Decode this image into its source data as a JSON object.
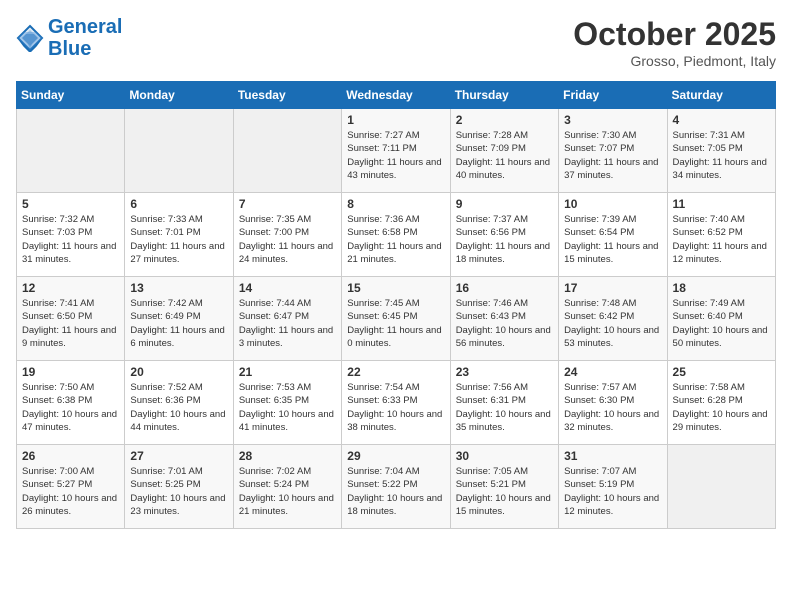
{
  "header": {
    "logo_line1": "General",
    "logo_line2": "Blue",
    "month": "October 2025",
    "location": "Grosso, Piedmont, Italy"
  },
  "days_of_week": [
    "Sunday",
    "Monday",
    "Tuesday",
    "Wednesday",
    "Thursday",
    "Friday",
    "Saturday"
  ],
  "weeks": [
    [
      {
        "day": "",
        "sunrise": "",
        "sunset": "",
        "daylight": ""
      },
      {
        "day": "",
        "sunrise": "",
        "sunset": "",
        "daylight": ""
      },
      {
        "day": "",
        "sunrise": "",
        "sunset": "",
        "daylight": ""
      },
      {
        "day": "1",
        "sunrise": "Sunrise: 7:27 AM",
        "sunset": "Sunset: 7:11 PM",
        "daylight": "Daylight: 11 hours and 43 minutes."
      },
      {
        "day": "2",
        "sunrise": "Sunrise: 7:28 AM",
        "sunset": "Sunset: 7:09 PM",
        "daylight": "Daylight: 11 hours and 40 minutes."
      },
      {
        "day": "3",
        "sunrise": "Sunrise: 7:30 AM",
        "sunset": "Sunset: 7:07 PM",
        "daylight": "Daylight: 11 hours and 37 minutes."
      },
      {
        "day": "4",
        "sunrise": "Sunrise: 7:31 AM",
        "sunset": "Sunset: 7:05 PM",
        "daylight": "Daylight: 11 hours and 34 minutes."
      }
    ],
    [
      {
        "day": "5",
        "sunrise": "Sunrise: 7:32 AM",
        "sunset": "Sunset: 7:03 PM",
        "daylight": "Daylight: 11 hours and 31 minutes."
      },
      {
        "day": "6",
        "sunrise": "Sunrise: 7:33 AM",
        "sunset": "Sunset: 7:01 PM",
        "daylight": "Daylight: 11 hours and 27 minutes."
      },
      {
        "day": "7",
        "sunrise": "Sunrise: 7:35 AM",
        "sunset": "Sunset: 7:00 PM",
        "daylight": "Daylight: 11 hours and 24 minutes."
      },
      {
        "day": "8",
        "sunrise": "Sunrise: 7:36 AM",
        "sunset": "Sunset: 6:58 PM",
        "daylight": "Daylight: 11 hours and 21 minutes."
      },
      {
        "day": "9",
        "sunrise": "Sunrise: 7:37 AM",
        "sunset": "Sunset: 6:56 PM",
        "daylight": "Daylight: 11 hours and 18 minutes."
      },
      {
        "day": "10",
        "sunrise": "Sunrise: 7:39 AM",
        "sunset": "Sunset: 6:54 PM",
        "daylight": "Daylight: 11 hours and 15 minutes."
      },
      {
        "day": "11",
        "sunrise": "Sunrise: 7:40 AM",
        "sunset": "Sunset: 6:52 PM",
        "daylight": "Daylight: 11 hours and 12 minutes."
      }
    ],
    [
      {
        "day": "12",
        "sunrise": "Sunrise: 7:41 AM",
        "sunset": "Sunset: 6:50 PM",
        "daylight": "Daylight: 11 hours and 9 minutes."
      },
      {
        "day": "13",
        "sunrise": "Sunrise: 7:42 AM",
        "sunset": "Sunset: 6:49 PM",
        "daylight": "Daylight: 11 hours and 6 minutes."
      },
      {
        "day": "14",
        "sunrise": "Sunrise: 7:44 AM",
        "sunset": "Sunset: 6:47 PM",
        "daylight": "Daylight: 11 hours and 3 minutes."
      },
      {
        "day": "15",
        "sunrise": "Sunrise: 7:45 AM",
        "sunset": "Sunset: 6:45 PM",
        "daylight": "Daylight: 11 hours and 0 minutes."
      },
      {
        "day": "16",
        "sunrise": "Sunrise: 7:46 AM",
        "sunset": "Sunset: 6:43 PM",
        "daylight": "Daylight: 10 hours and 56 minutes."
      },
      {
        "day": "17",
        "sunrise": "Sunrise: 7:48 AM",
        "sunset": "Sunset: 6:42 PM",
        "daylight": "Daylight: 10 hours and 53 minutes."
      },
      {
        "day": "18",
        "sunrise": "Sunrise: 7:49 AM",
        "sunset": "Sunset: 6:40 PM",
        "daylight": "Daylight: 10 hours and 50 minutes."
      }
    ],
    [
      {
        "day": "19",
        "sunrise": "Sunrise: 7:50 AM",
        "sunset": "Sunset: 6:38 PM",
        "daylight": "Daylight: 10 hours and 47 minutes."
      },
      {
        "day": "20",
        "sunrise": "Sunrise: 7:52 AM",
        "sunset": "Sunset: 6:36 PM",
        "daylight": "Daylight: 10 hours and 44 minutes."
      },
      {
        "day": "21",
        "sunrise": "Sunrise: 7:53 AM",
        "sunset": "Sunset: 6:35 PM",
        "daylight": "Daylight: 10 hours and 41 minutes."
      },
      {
        "day": "22",
        "sunrise": "Sunrise: 7:54 AM",
        "sunset": "Sunset: 6:33 PM",
        "daylight": "Daylight: 10 hours and 38 minutes."
      },
      {
        "day": "23",
        "sunrise": "Sunrise: 7:56 AM",
        "sunset": "Sunset: 6:31 PM",
        "daylight": "Daylight: 10 hours and 35 minutes."
      },
      {
        "day": "24",
        "sunrise": "Sunrise: 7:57 AM",
        "sunset": "Sunset: 6:30 PM",
        "daylight": "Daylight: 10 hours and 32 minutes."
      },
      {
        "day": "25",
        "sunrise": "Sunrise: 7:58 AM",
        "sunset": "Sunset: 6:28 PM",
        "daylight": "Daylight: 10 hours and 29 minutes."
      }
    ],
    [
      {
        "day": "26",
        "sunrise": "Sunrise: 7:00 AM",
        "sunset": "Sunset: 5:27 PM",
        "daylight": "Daylight: 10 hours and 26 minutes."
      },
      {
        "day": "27",
        "sunrise": "Sunrise: 7:01 AM",
        "sunset": "Sunset: 5:25 PM",
        "daylight": "Daylight: 10 hours and 23 minutes."
      },
      {
        "day": "28",
        "sunrise": "Sunrise: 7:02 AM",
        "sunset": "Sunset: 5:24 PM",
        "daylight": "Daylight: 10 hours and 21 minutes."
      },
      {
        "day": "29",
        "sunrise": "Sunrise: 7:04 AM",
        "sunset": "Sunset: 5:22 PM",
        "daylight": "Daylight: 10 hours and 18 minutes."
      },
      {
        "day": "30",
        "sunrise": "Sunrise: 7:05 AM",
        "sunset": "Sunset: 5:21 PM",
        "daylight": "Daylight: 10 hours and 15 minutes."
      },
      {
        "day": "31",
        "sunrise": "Sunrise: 7:07 AM",
        "sunset": "Sunset: 5:19 PM",
        "daylight": "Daylight: 10 hours and 12 minutes."
      },
      {
        "day": "",
        "sunrise": "",
        "sunset": "",
        "daylight": ""
      }
    ]
  ]
}
